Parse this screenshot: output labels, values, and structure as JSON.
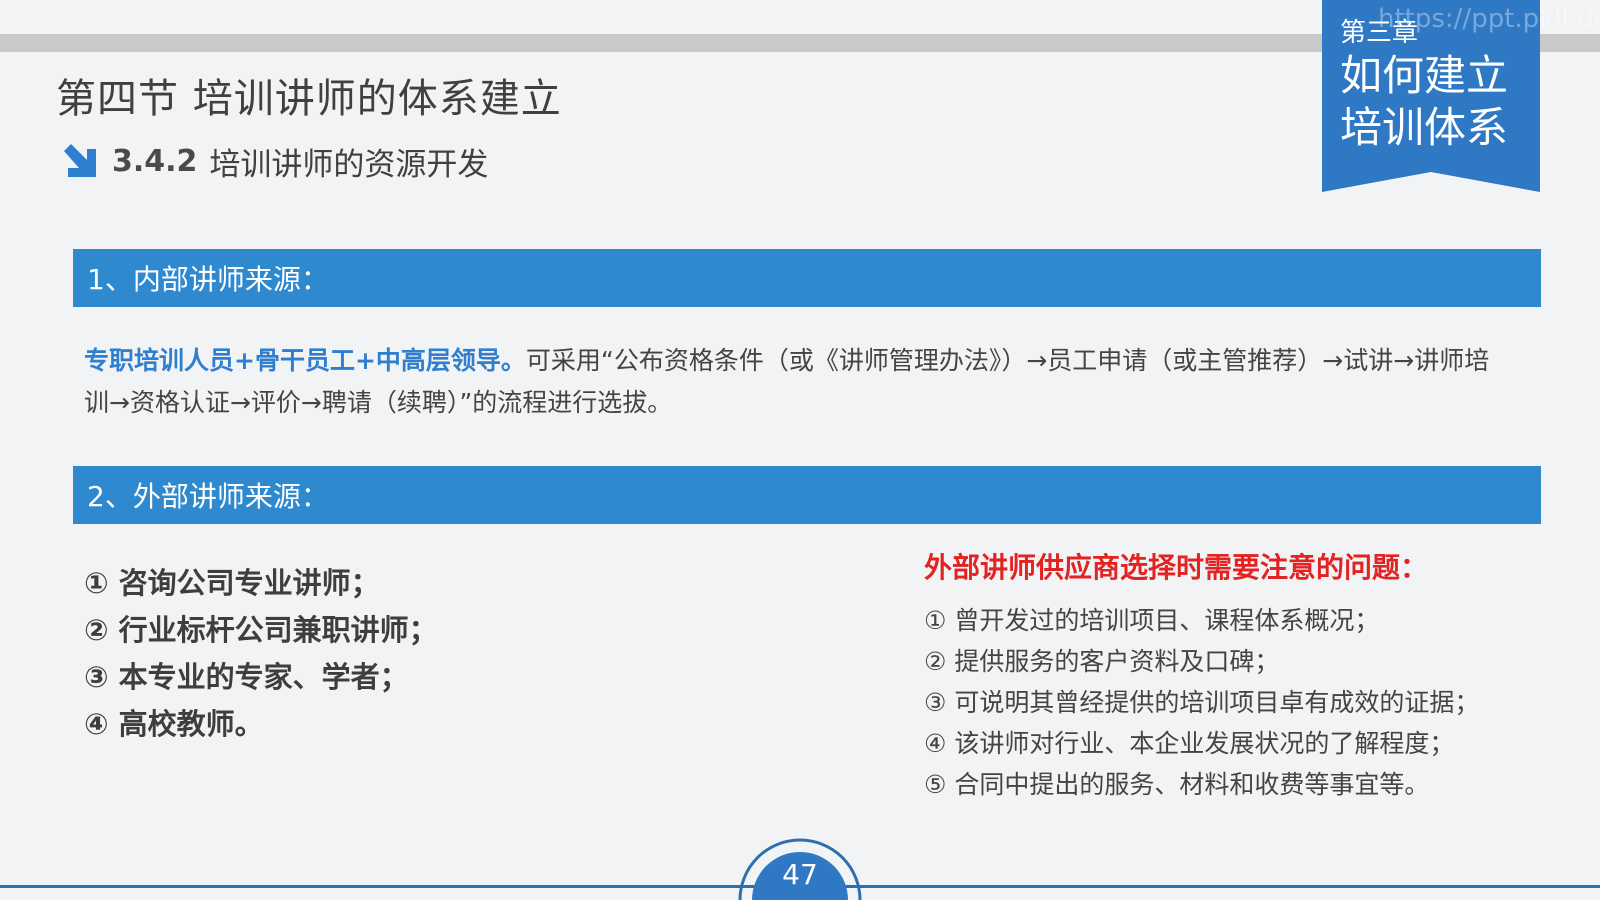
{
  "header": {
    "section_title": "第四节  培训讲师的体系建立",
    "subsection_number": "3.4.2",
    "subsection_title": "培训讲师的资源开发"
  },
  "chapter": {
    "label": "第三章",
    "title": "如何建立培训体系",
    "watermark": "https://ppt.pkll.de"
  },
  "internal": {
    "heading": "1、内部讲师来源：",
    "highlight": "专职培训人员+骨干员工+中高层领导。",
    "text": "可采用“公布资格条件（或《讲师管理办法》）→员工申请（或主管推荐）→试讲→讲师培训→资格认证→评价→聘请（续聘）”的流程进行选拔。"
  },
  "external": {
    "heading": "2、外部讲师来源：",
    "sources": [
      "① 咨询公司专业讲师；",
      "② 行业标杆公司兼职讲师；",
      "③ 本专业的专家、学者；",
      "④ 高校教师。"
    ],
    "notice_title": "外部讲师供应商选择时需要注意的问题：",
    "notices": [
      "① 曾开发过的培训项目、课程体系概况；",
      "② 提供服务的客户资料及口碑；",
      "③ 可说明其曾经提供的培训项目卓有成效的证据；",
      "④ 该讲师对行业、本企业发展状况的了解程度；",
      "⑤ 合同中提出的服务、材料和收费等事宜等。"
    ]
  },
  "footer": {
    "page_number": "47"
  },
  "colors": {
    "accent_blue": "#2f89cf",
    "alert_red": "#e32222",
    "highlight_blue": "#2f7fd0"
  }
}
